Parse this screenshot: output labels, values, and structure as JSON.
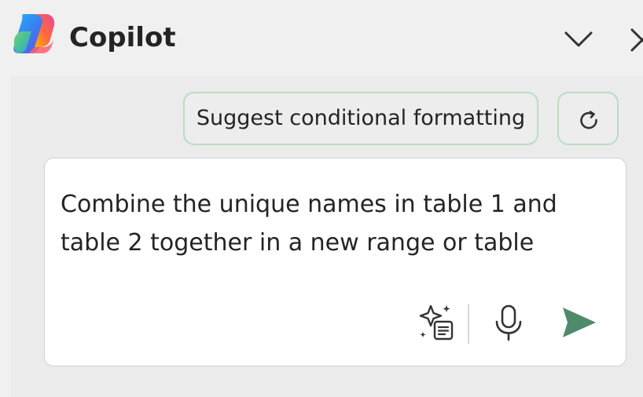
{
  "header": {
    "title": "Copilot",
    "logo_icon": "copilot-logo",
    "collapse_icon": "chevron-down-icon",
    "close_icon": "close-icon"
  },
  "suggestions": [
    {
      "label": "Suggest conditional formatting"
    }
  ],
  "refresh_icon": "refresh-icon",
  "composer": {
    "text": "Combine the unique names in table 1 and table 2 together in a new range or table",
    "line1": "Combine the unique names in table 1 and",
    "line2": "table 2 together in a new range or table",
    "prompt_icon": "sparkle-prompt-icon",
    "mic_icon": "microphone-icon",
    "send_icon": "send-icon"
  },
  "colors": {
    "background": "#f0f0f0",
    "panel": "#ebebeb",
    "chip_border": "#b9dcc4",
    "send": "#4f8a6b",
    "text": "#242424"
  }
}
